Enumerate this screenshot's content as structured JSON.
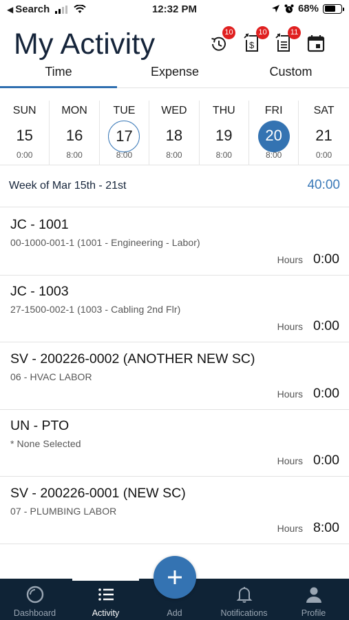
{
  "status_bar": {
    "back_label": "Search",
    "time": "12:32 PM",
    "battery": "68%"
  },
  "header": {
    "title": "My Activity",
    "icons": [
      {
        "name": "time-entries-icon",
        "badge": "10"
      },
      {
        "name": "expense-icon",
        "badge": "10"
      },
      {
        "name": "checklist-icon",
        "badge": "11"
      },
      {
        "name": "calendar-icon",
        "badge": ""
      }
    ]
  },
  "tabs": [
    "Time",
    "Expense",
    "Custom"
  ],
  "active_tab": "Time",
  "days": [
    {
      "name": "SUN",
      "num": "15",
      "hours": "0:00"
    },
    {
      "name": "MON",
      "num": "16",
      "hours": "8:00"
    },
    {
      "name": "TUE",
      "num": "17",
      "hours": "8:00"
    },
    {
      "name": "WED",
      "num": "18",
      "hours": "8:00"
    },
    {
      "name": "THU",
      "num": "19",
      "hours": "8:00"
    },
    {
      "name": "FRI",
      "num": "20",
      "hours": "8:00"
    },
    {
      "name": "SAT",
      "num": "21",
      "hours": "0:00"
    }
  ],
  "today_day": "17",
  "selected_day": "20",
  "week": {
    "label": "Week of Mar 15th - 21st",
    "total": "40:00"
  },
  "entries": [
    {
      "title": "JC - 1001",
      "subtitle": "00-1000-001-1 (1001 - Engineering - Labor)",
      "hours_label": "Hours",
      "hours": "0:00"
    },
    {
      "title": "JC - 1003",
      "subtitle": "27-1500-002-1 (1003 - Cabling 2nd Flr)",
      "hours_label": "Hours",
      "hours": "0:00"
    },
    {
      "title": "SV - 200226-0002 (ANOTHER NEW SC)",
      "subtitle": "06 - HVAC LABOR",
      "hours_label": "Hours",
      "hours": "0:00"
    },
    {
      "title": "UN - PTO",
      "subtitle": "* None Selected",
      "hours_label": "Hours",
      "hours": "0:00"
    },
    {
      "title": "SV - 200226-0001 (NEW SC)",
      "subtitle": "07 - PLUMBING LABOR",
      "hours_label": "Hours",
      "hours": "8:00"
    }
  ],
  "bottom_nav": {
    "items": [
      {
        "label": "Dashboard",
        "icon": "dashboard-icon"
      },
      {
        "label": "Activity",
        "icon": "list-icon"
      },
      {
        "label": "Add",
        "icon": "plus-icon"
      },
      {
        "label": "Notifications",
        "icon": "bell-icon"
      },
      {
        "label": "Profile",
        "icon": "person-icon"
      }
    ],
    "active": "Activity"
  },
  "colors": {
    "accent": "#3473b2",
    "title": "#15243a",
    "nav_bg": "#0f2336",
    "badge": "#e02020"
  }
}
